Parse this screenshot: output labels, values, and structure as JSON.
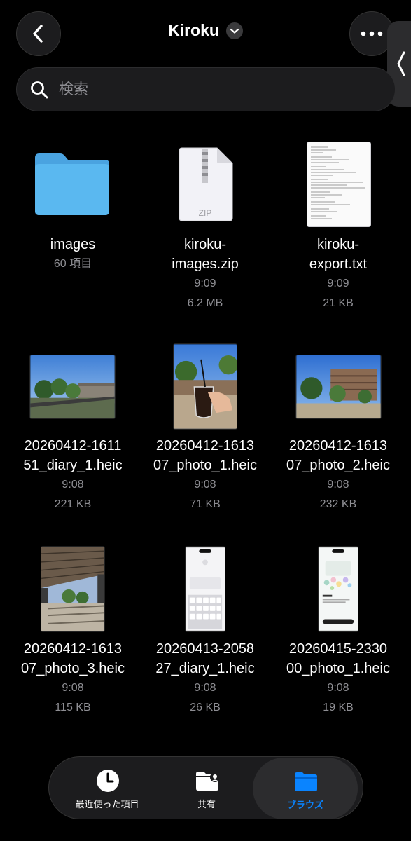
{
  "header": {
    "title": "Kiroku",
    "back_icon": "chevron-left-icon",
    "more_icon": "ellipsis-icon"
  },
  "search": {
    "placeholder": "検索"
  },
  "items": [
    {
      "name_lines": [
        "images",
        ""
      ],
      "meta_lines": [
        "60 項目",
        ""
      ],
      "type": "folder"
    },
    {
      "name_lines": [
        "kiroku-",
        "images.zip"
      ],
      "meta_lines": [
        "9:09",
        "6.2 MB"
      ],
      "type": "zip",
      "badge": "ZIP"
    },
    {
      "name_lines": [
        "kiroku-",
        "export.txt"
      ],
      "meta_lines": [
        "9:09",
        "21 KB"
      ],
      "type": "text"
    },
    {
      "name_lines": [
        "20260412-1611",
        "51_diary_1.heic"
      ],
      "meta_lines": [
        "9:08",
        "221 KB"
      ],
      "type": "photo"
    },
    {
      "name_lines": [
        "20260412-1613",
        "07_photo_1.heic"
      ],
      "meta_lines": [
        "9:08",
        "71 KB"
      ],
      "type": "photo"
    },
    {
      "name_lines": [
        "20260412-1613",
        "07_photo_2.heic"
      ],
      "meta_lines": [
        "9:08",
        "232 KB"
      ],
      "type": "photo"
    },
    {
      "name_lines": [
        "20260412-1613",
        "07_photo_3.heic"
      ],
      "meta_lines": [
        "9:08",
        "115 KB"
      ],
      "type": "photo"
    },
    {
      "name_lines": [
        "20260413-2058",
        "27_diary_1.heic"
      ],
      "meta_lines": [
        "9:08",
        "26 KB"
      ],
      "type": "screenshot"
    },
    {
      "name_lines": [
        "20260415-2330",
        "00_photo_1.heic"
      ],
      "meta_lines": [
        "9:08",
        "19 KB"
      ],
      "type": "screenshot"
    }
  ],
  "tabbar": {
    "tabs": [
      {
        "label": "最近使った項目",
        "icon": "clock-icon",
        "active": false
      },
      {
        "label": "共有",
        "icon": "shared-folder-icon",
        "active": false
      },
      {
        "label": "ブラウズ",
        "icon": "folder-icon",
        "active": true
      }
    ]
  },
  "colors": {
    "accent": "#0a84ff",
    "folder": "#5ab4ee",
    "background": "#000000"
  }
}
